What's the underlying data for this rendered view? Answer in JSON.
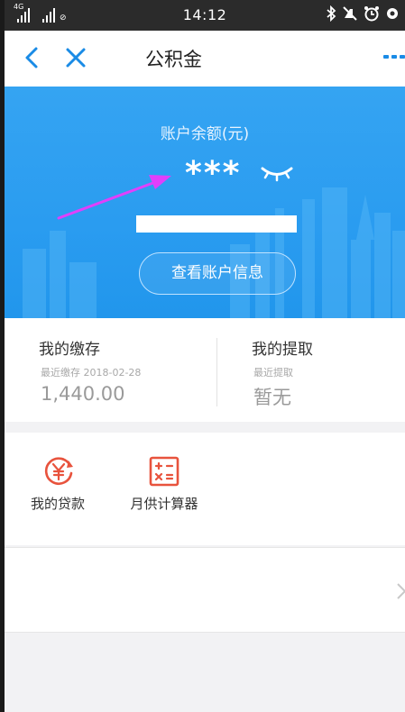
{
  "status_bar": {
    "network": "4G",
    "extra": "⊘",
    "time": "14:12",
    "icons": [
      "bluetooth-icon",
      "mute-icon",
      "alarm-icon",
      "settings-icon"
    ]
  },
  "nav": {
    "title": "公积金",
    "back_icon": "chevron-left-icon",
    "close_icon": "close-icon",
    "more_icon": "more-icon"
  },
  "balance": {
    "label": "账户余额(元)",
    "value": "***",
    "view_button": "查看账户信息",
    "colors": {
      "panel": "#2a9cf0",
      "arrow": "#e040fb"
    }
  },
  "stats": {
    "deposit": {
      "title": "我的缴存",
      "sub": "最近缴存 2018-02-28",
      "value": "1,440.00"
    },
    "withdraw": {
      "title": "我的提取",
      "sub": "最近提取",
      "value": "暂无"
    }
  },
  "tools": [
    {
      "label": "我的贷款",
      "icon": "loan-yen-icon"
    },
    {
      "label": "月供计算器",
      "icon": "calculator-icon"
    }
  ],
  "accent": "#e8533d"
}
